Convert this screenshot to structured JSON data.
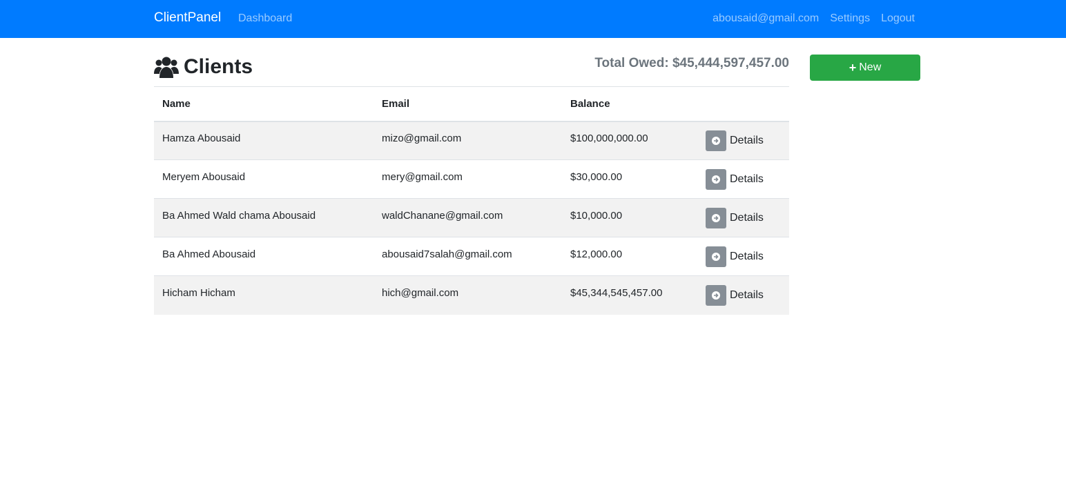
{
  "navbar": {
    "brand": "ClientPanel",
    "dashboard": "Dashboard",
    "user_email": "abousaid@gmail.com",
    "settings": "Settings",
    "logout": "Logout"
  },
  "page": {
    "title": "Clients",
    "title_icon": "users-icon",
    "total_label": "Total Owed:",
    "total_amount": "$45,444,597,457.00",
    "new_button_label": "New",
    "new_button_icon": "plus-icon"
  },
  "table": {
    "headers": [
      "Name",
      "Email",
      "Balance"
    ],
    "rows": [
      {
        "name": "Hamza Abousaid",
        "email": "mizo@gmail.com",
        "balance": "$100,000,000.00",
        "action": "Details"
      },
      {
        "name": "Meryem Abousaid",
        "email": "mery@gmail.com",
        "balance": "$30,000.00",
        "action": "Details"
      },
      {
        "name": "Ba Ahmed Wald chama Abousaid",
        "email": "waldChanane@gmail.com",
        "balance": "$10,000.00",
        "action": "Details"
      },
      {
        "name": "Ba Ahmed Abousaid",
        "email": "abousaid7salah@gmail.com",
        "balance": "$12,000.00",
        "action": "Details"
      },
      {
        "name": "Hicham Hicham",
        "email": "hich@gmail.com",
        "balance": "$45,344,545,457.00",
        "action": "Details"
      }
    ]
  },
  "colors": {
    "navbar": "#007bff",
    "new_button": "#28a745",
    "details_icon_bg": "#868e96",
    "striped_row": "#f2f2f2"
  }
}
